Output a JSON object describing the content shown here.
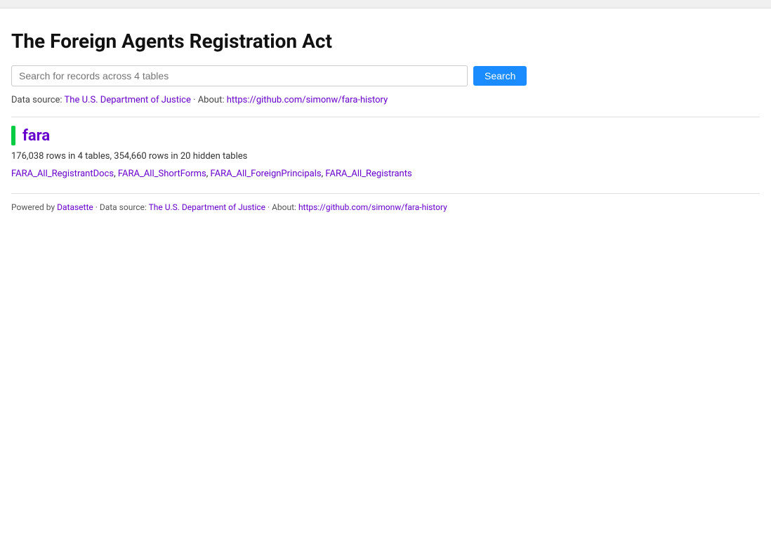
{
  "topbar": {
    "visible": true
  },
  "header": {
    "title": "The Foreign Agents Registration Act"
  },
  "search": {
    "placeholder": "Search for records across 4 tables",
    "button_label": "Search"
  },
  "datasource": {
    "prefix": "Data source: ",
    "source_link_text": "The U.S. Department of Justice",
    "source_link_href": "#",
    "about_prefix": " · About: ",
    "about_link_text": "https://github.com/simonw/fara-history",
    "about_link_href": "#"
  },
  "database": {
    "color_bar_color": "#00cc44",
    "name": "fara",
    "name_href": "#",
    "rows_info": "176,038 rows in 4 tables, 354,660 rows in 20 hidden tables",
    "tables": [
      {
        "label": "FARA_All_RegistrantDocs",
        "href": "#"
      },
      {
        "label": "FARA_All_ShortForms",
        "href": "#"
      },
      {
        "label": "FARA_All_ForeignPrincipals",
        "href": "#"
      },
      {
        "label": "FARA_All_Registrants",
        "href": "#"
      }
    ]
  },
  "footer": {
    "powered_by_prefix": "Powered by ",
    "datasette_label": "Datasette",
    "datasette_href": "#",
    "data_source_prefix": " · Data source: ",
    "source_link_text": "The U.S. Department of Justice",
    "source_link_href": "#",
    "about_prefix": " · About: ",
    "about_link_text": "https://github.com/simonw/fara-history",
    "about_link_href": "#"
  }
}
